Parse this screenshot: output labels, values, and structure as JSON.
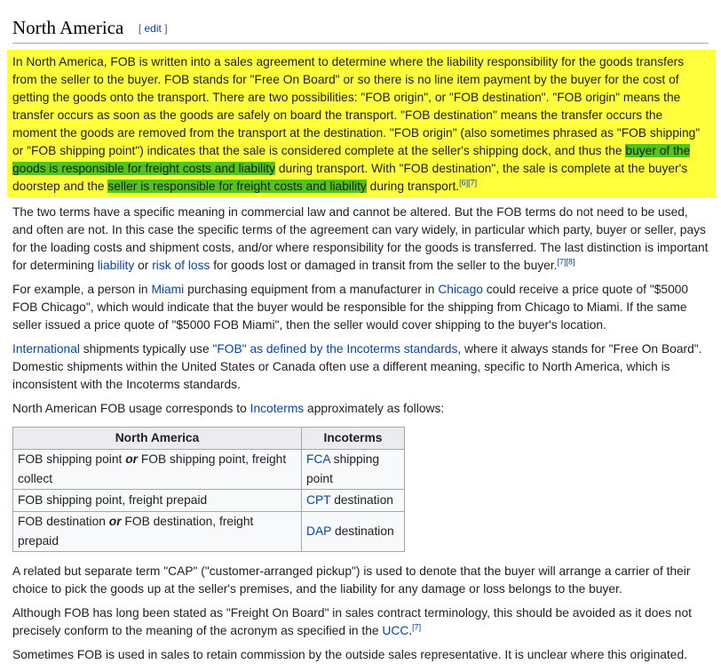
{
  "section": {
    "title": "North America",
    "edit_open": "[ ",
    "edit_label": "edit",
    "edit_close": " ]"
  },
  "p1": {
    "text_a": "In North America, FOB is written into a sales agreement to determine where the liability responsibility for the goods transfers from the seller to the buyer. FOB stands for \"Free On Board\" or so there is no line item payment by the buyer for the cost of getting the goods onto the transport. There are two possibilities: \"FOB origin\", or \"FOB destination\". \"FOB origin\" means the transfer occurs as soon as the goods are safely on board the transport. \"FOB destination\" means the transfer occurs the moment the goods are removed from the transport at the destination. \"FOB origin\" (also sometimes phrased as \"FOB shipping\" or \"FOB shipping point\") indicates that the sale is considered complete at the seller's shipping dock, and thus the ",
    "highlight_1": "buyer of the goods is responsible for freight costs and liability",
    "text_b": " during transport. With \"FOB destination\", the sale is complete at the buyer's doorstep and the ",
    "highlight_2": "seller is responsible for freight costs and liability",
    "text_c": " during transport.",
    "cite": "[6][7]"
  },
  "p2": {
    "text_a": "The two terms have a specific meaning in commercial law and cannot be altered. But the FOB terms do not need to be used, and often are not. In this case the specific terms of the agreement can vary widely, in particular which party, buyer or seller, pays for the loading costs and shipment costs, and/or where responsibility for the goods is transferred. The last distinction is important for determining ",
    "link_1": "liability",
    "text_b": " or ",
    "link_2": "risk of loss",
    "text_c": " for goods lost or damaged in transit from the seller to the buyer.",
    "cite": "[7][8]"
  },
  "p3": {
    "text_a": "For example, a person in ",
    "link_1": "Miami",
    "text_b": " purchasing equipment from a manufacturer in ",
    "link_2": "Chicago",
    "text_c": " could receive a price quote of \"$5000 FOB Chicago\", which would indicate that the buyer would be responsible for the shipping from Chicago to Miami. If the same seller issued a price quote of \"$5000 FOB Miami\", then the seller would cover shipping to the buyer's location."
  },
  "p4": {
    "link_1": "International",
    "text_a": " shipments typically use ",
    "link_2": "\"FOB\" as defined by the Incoterms standards",
    "text_b": ", where it always stands for \"Free On Board\". Domestic shipments within the United States or Canada often use a different meaning, specific to North America, which is inconsistent with the Incoterms standards."
  },
  "p5": {
    "text_a": "North American FOB usage corresponds to ",
    "link_1": "Incoterms",
    "text_b": " approximately as follows:"
  },
  "table": {
    "headers": [
      "North America",
      "Incoterms"
    ],
    "rows": [
      {
        "na_a": "FOB shipping point ",
        "na_or": "or",
        "na_b": " FOB shipping point, freight collect",
        "inc_link": "FCA",
        "inc_text": " shipping point"
      },
      {
        "na_a": "FOB shipping point, freight prepaid",
        "na_or": "",
        "na_b": "",
        "inc_link": "CPT",
        "inc_text": " destination"
      },
      {
        "na_a": "FOB destination ",
        "na_or": "or",
        "na_b": " FOB destination, freight prepaid",
        "inc_link": "DAP",
        "inc_text": " destination"
      }
    ]
  },
  "p6": {
    "text_a": "A related but separate term \"CAP\" (\"customer-arranged pickup\") is used to denote that the buyer will arrange a carrier of their choice to pick the goods up at the seller's premises, and the liability for any damage or loss belongs to the buyer."
  },
  "p7": {
    "text_a": "Although FOB has long been stated as \"Freight On Board\" in sales contract terminology, this should be avoided as it does not precisely conform to the meaning of the acronym as specified in the ",
    "link_1": "UCC",
    "text_b": ".",
    "cite": "[7]"
  },
  "p8": {
    "text_a": "Sometimes FOB is used in sales to retain commission by the outside sales representative. It is unclear where this originated."
  },
  "colors": {
    "highlight_yellow": "#ffff3c",
    "highlight_green": "#52c41a",
    "link": "#0645ad"
  }
}
